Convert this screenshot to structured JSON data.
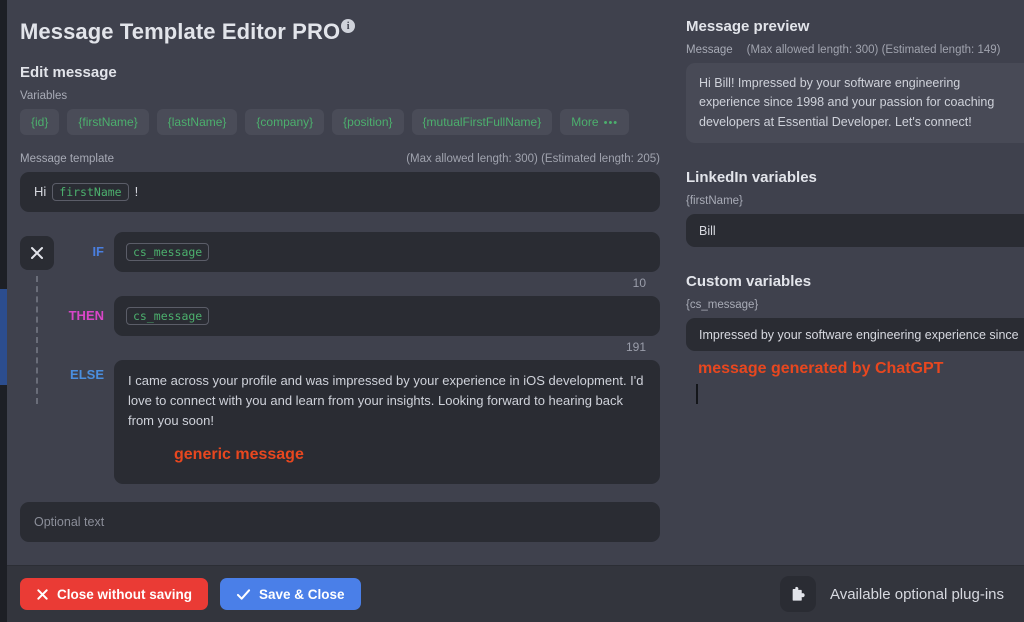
{
  "window": {
    "title": "Message Template Editor PRO",
    "info_icon": "info-icon"
  },
  "editor": {
    "heading": "Edit message",
    "variables_label": "Variables",
    "variable_chips": [
      "{id}",
      "{firstName}",
      "{lastName}",
      "{company}",
      "{position}",
      "{mutualFirstFullName}"
    ],
    "more_chip_label": "More",
    "more_chip_dots": "•••",
    "message_template_label": "Message template",
    "message_template_max": "(Max allowed length: 300)",
    "message_template_estimated": "(Estimated length: 205)",
    "template_prefix": "Hi",
    "template_token": "firstName",
    "template_suffix": "!",
    "close_branch_icon": "close-icon",
    "condition": {
      "if_label": "IF",
      "if_value": "cs_message",
      "if_counter": "10",
      "then_label": "THEN",
      "then_value": "cs_message",
      "then_counter": "191",
      "else_label": "ELSE",
      "else_value": "I came across your profile and was impressed by your experience in iOS development. I'd love to connect with you and learn from your insights. Looking forward to hearing back from you soon!",
      "else_annotation": "generic message"
    },
    "optional_text_placeholder": "Optional text"
  },
  "preview": {
    "heading": "Message preview",
    "message_label": "Message",
    "max_length": "(Max allowed length: 300)",
    "estimated_length": "(Estimated length: 149)",
    "body": "Hi Bill! Impressed by your software engineering experience since 1998 and your passion for coaching developers at Essential Developer. Let's connect!"
  },
  "linkedin_variables": {
    "heading": "LinkedIn variables",
    "items": [
      {
        "name": "{firstName}",
        "value": "Bill"
      }
    ]
  },
  "custom_variables": {
    "heading": "Custom variables",
    "items": [
      {
        "name": "{cs_message}",
        "value": "Impressed by your software engineering experience since"
      }
    ],
    "annotation": "message generated by ChatGPT"
  },
  "footer": {
    "close_label": "Close without saving",
    "close_icon": "close-icon",
    "save_label": "Save & Close",
    "save_icon": "check-icon",
    "plugins_icon": "puzzle-piece-icon",
    "plugins_label": "Available optional plug-ins"
  },
  "colors": {
    "background": "#3f414d",
    "field": "#2a2c33",
    "chip": "#4a4c58",
    "variable_green": "#4caf6d",
    "if_blue": "#4a7fe0",
    "then_magenta": "#d946c8",
    "else_blue": "#4a8fe0",
    "annotation_red": "#e8471f",
    "danger": "#ea3b35",
    "primary": "#4a7fe8",
    "edge_blue": "#2c4d8e"
  }
}
